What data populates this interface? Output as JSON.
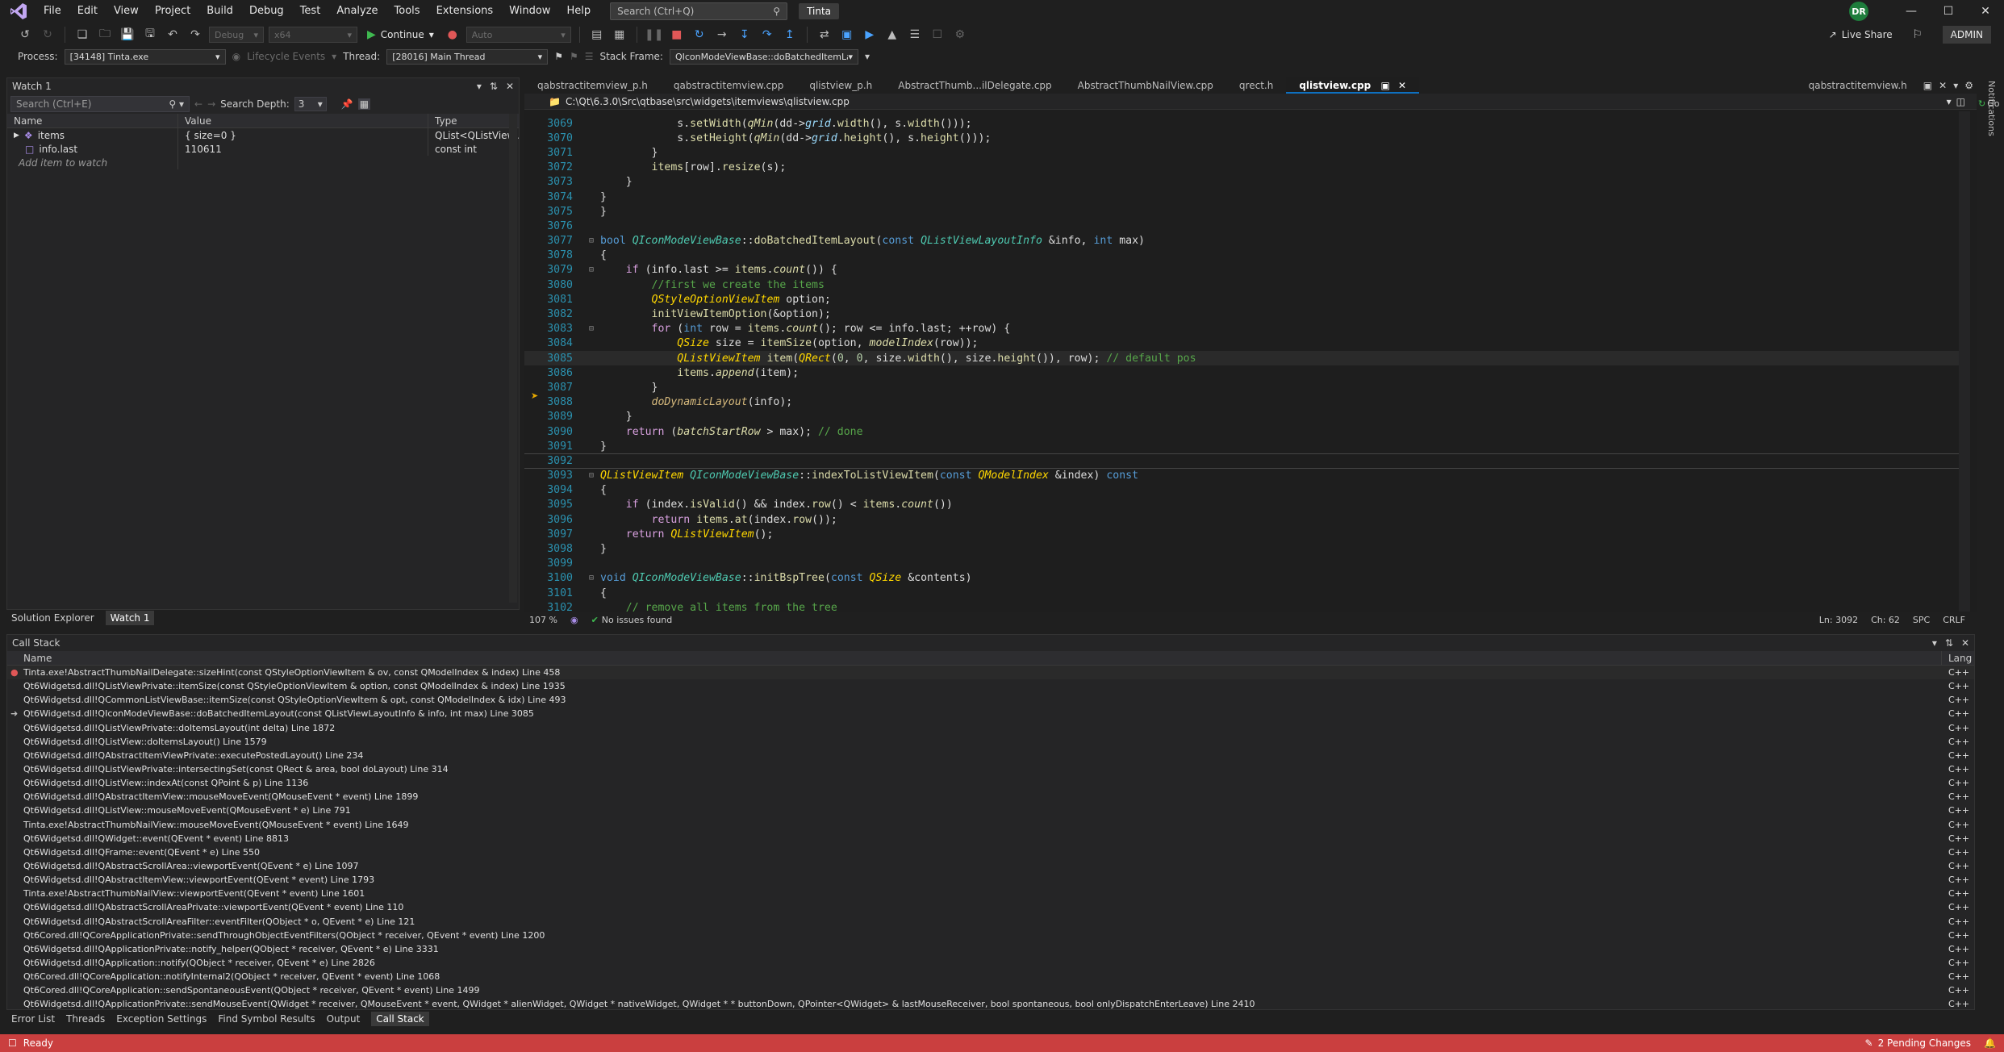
{
  "menubar": {
    "items": [
      "File",
      "Edit",
      "View",
      "Project",
      "Build",
      "Debug",
      "Test",
      "Analyze",
      "Tools",
      "Extensions",
      "Window",
      "Help"
    ],
    "search_placeholder": "Search (Ctrl+Q)",
    "solution_name": "Tinta",
    "user_initials": "DR",
    "live_share": "Live Share",
    "admin": "ADMIN"
  },
  "toolbar": {
    "config": "Debug",
    "platform": "x64",
    "continue_label": "Continue",
    "auto_label": "Auto"
  },
  "locbar": {
    "process_label": "Process:",
    "process_value": "[34148] Tinta.exe",
    "lifecycle_label": "Lifecycle Events",
    "thread_label": "Thread:",
    "thread_value": "[28016] Main Thread",
    "stackframe_label": "Stack Frame:",
    "stackframe_value": "QIconModeViewBase::doBatchedItemLayout"
  },
  "watch": {
    "title": "Watch 1",
    "search_placeholder": "Search (Ctrl+E)",
    "search_depth_label": "Search Depth:",
    "search_depth_value": "3",
    "columns": [
      "Name",
      "Value",
      "Type"
    ],
    "rows": [
      {
        "name": "items",
        "value": "{ size=0 }",
        "type": "QList<QListView..."
      },
      {
        "name": "info.last",
        "value": "110611",
        "type": "const int"
      }
    ],
    "add_item": "Add item to watch",
    "tabs": [
      "Solution Explorer",
      "Watch 1"
    ]
  },
  "editor": {
    "tabs": [
      "qabstractitemview_p.h",
      "qabstractitemview.cpp",
      "qlistview_p.h",
      "AbstractThumb...ilDelegate.cpp",
      "AbstractThumbNailView.cpp",
      "qrect.h",
      "qlistview.cpp"
    ],
    "right_tab": "qabstractitemview.h",
    "path": "C:\\Qt\\6.3.0\\Src\\qtbase\\src\\widgets\\itemviews\\qlistview.cpp",
    "status": {
      "zoom": "107 %",
      "issues": "No issues found",
      "ln": "Ln: 3092",
      "ch": "Ch: 62",
      "spc": "SPC",
      "crlf": "CRLF"
    },
    "right_go": "Go"
  },
  "code_lines": [
    {
      "n": "3069",
      "t": "            s.setWidth(qMin(dd->grid.width(), s.width()));"
    },
    {
      "n": "3070",
      "t": "            s.setHeight(qMin(dd->grid.height(), s.height()));"
    },
    {
      "n": "3071",
      "t": "        }"
    },
    {
      "n": "3072",
      "t": "        items[row].resize(s);"
    },
    {
      "n": "3073",
      "t": "    }"
    },
    {
      "n": "3074",
      "t": "}"
    },
    {
      "n": "3075",
      "t": "}"
    },
    {
      "n": "3076",
      "t": ""
    },
    {
      "n": "3077",
      "t": "bool QIconModeViewBase::doBatchedItemLayout(const QListViewLayoutInfo &info, int max)"
    },
    {
      "n": "3078",
      "t": "{"
    },
    {
      "n": "3079",
      "t": "    if (info.last >= items.count()) {"
    },
    {
      "n": "3080",
      "t": "        //first we create the items"
    },
    {
      "n": "3081",
      "t": "        QStyleOptionViewItem option;"
    },
    {
      "n": "3082",
      "t": "        initViewItemOption(&option);"
    },
    {
      "n": "3083",
      "t": "        for (int row = items.count(); row <= info.last; ++row) {"
    },
    {
      "n": "3084",
      "t": "            QSize size = itemSize(option, modelIndex(row));"
    },
    {
      "n": "3085",
      "t": "            QListViewItem item(QRect(0, 0, size.width(), size.height()), row); // default pos"
    },
    {
      "n": "3086",
      "t": "            items.append(item);"
    },
    {
      "n": "3087",
      "t": "        }"
    },
    {
      "n": "3088",
      "t": "        doDynamicLayout(info);"
    },
    {
      "n": "3089",
      "t": "    }"
    },
    {
      "n": "3090",
      "t": "    return (batchStartRow > max); // done"
    },
    {
      "n": "3091",
      "t": "}"
    },
    {
      "n": "3092",
      "t": ""
    },
    {
      "n": "3093",
      "t": "QListViewItem QIconModeViewBase::indexToListViewItem(const QModelIndex &index) const"
    },
    {
      "n": "3094",
      "t": "{"
    },
    {
      "n": "3095",
      "t": "    if (index.isValid() && index.row() < items.count())"
    },
    {
      "n": "3096",
      "t": "        return items.at(index.row());"
    },
    {
      "n": "3097",
      "t": "    return QListViewItem();"
    },
    {
      "n": "3098",
      "t": "}"
    },
    {
      "n": "3099",
      "t": ""
    },
    {
      "n": "3100",
      "t": "void QIconModeViewBase::initBspTree(const QSize &contents)"
    },
    {
      "n": "3101",
      "t": "{"
    },
    {
      "n": "3102",
      "t": "    // remove all items from the tree"
    }
  ],
  "callstack": {
    "title": "Call Stack",
    "columns": [
      "Name",
      "Lang"
    ],
    "rows": [
      "Tinta.exe!AbstractThumbNailDelegate::sizeHint(const QStyleOptionViewItem & ov, const QModelIndex & index) Line 458",
      "Qt6Widgetsd.dll!QListViewPrivate::itemSize(const QStyleOptionViewItem & option, const QModelIndex & index) Line 1935",
      "Qt6Widgetsd.dll!QCommonListViewBase::itemSize(const QStyleOptionViewItem & opt, const QModelIndex & idx) Line 493",
      "Qt6Widgetsd.dll!QIconModeViewBase::doBatchedItemLayout(const QListViewLayoutInfo & info, int max) Line 3085",
      "Qt6Widgetsd.dll!QListViewPrivate::doItemsLayout(int delta) Line 1872",
      "Qt6Widgetsd.dll!QListView::doItemsLayout() Line 1579",
      "Qt6Widgetsd.dll!QAbstractItemViewPrivate::executePostedLayout() Line 234",
      "Qt6Widgetsd.dll!QListViewPrivate::intersectingSet(const QRect & area, bool doLayout) Line 314",
      "Qt6Widgetsd.dll!QListView::indexAt(const QPoint & p) Line 1136",
      "Qt6Widgetsd.dll!QAbstractItemView::mouseMoveEvent(QMouseEvent * event) Line 1899",
      "Qt6Widgetsd.dll!QListView::mouseMoveEvent(QMouseEvent * e) Line 791",
      "Tinta.exe!AbstractThumbNailView::mouseMoveEvent(QMouseEvent * event) Line 1649",
      "Qt6Widgetsd.dll!QWidget::event(QEvent * event) Line 8813",
      "Qt6Widgetsd.dll!QFrame::event(QEvent * e) Line 550",
      "Qt6Widgetsd.dll!QAbstractScrollArea::viewportEvent(QEvent * e) Line 1097",
      "Qt6Widgetsd.dll!QAbstractItemView::viewportEvent(QEvent * event) Line 1793",
      "Tinta.exe!AbstractThumbNailView::viewportEvent(QEvent * event) Line 1601",
      "Qt6Widgetsd.dll!QAbstractScrollAreaPrivate::viewportEvent(QEvent * event) Line 110",
      "Qt6Widgetsd.dll!QAbstractScrollAreaFilter::eventFilter(QObject * o, QEvent * e) Line 121",
      "Qt6Cored.dll!QCoreApplicationPrivate::sendThroughObjectEventFilters(QObject * receiver, QEvent * event) Line 1200",
      "Qt6Widgetsd.dll!QApplicationPrivate::notify_helper(QObject * receiver, QEvent * e) Line 3331",
      "Qt6Widgetsd.dll!QApplication::notify(QObject * receiver, QEvent * e) Line 2826",
      "Qt6Cored.dll!QCoreApplication::notifyInternal2(QObject * receiver, QEvent * event) Line 1068",
      "Qt6Cored.dll!QCoreApplication::sendSpontaneousEvent(QObject * receiver, QEvent * event) Line 1499",
      "Qt6Widgetsd.dll!QApplicationPrivate::sendMouseEvent(QWidget * receiver, QMouseEvent * event, QWidget * alienWidget, QWidget * nativeWidget, QWidget * * buttonDown, QPointer<QWidget> & lastMouseReceiver, bool spontaneous, bool onlyDispatchEnterLeave) Line 2410"
    ],
    "lang": "C++"
  },
  "bottom_tabs": [
    "Error List",
    "Threads",
    "Exception Settings",
    "Find Symbol Results",
    "Output",
    "Call Stack"
  ],
  "statusbar": {
    "ready": "Ready",
    "pending": "2 Pending Changes"
  },
  "notifications_label": "Notifications"
}
